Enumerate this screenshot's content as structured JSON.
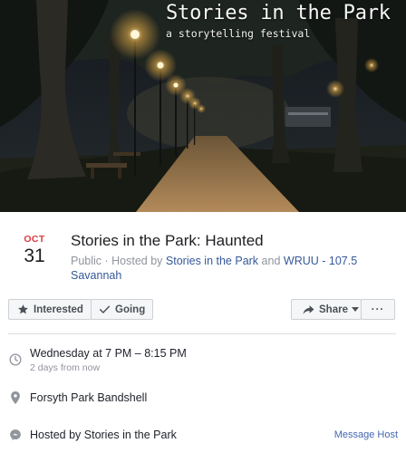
{
  "cover": {
    "title": "Stories in the Park",
    "subtitle": "a storytelling festival"
  },
  "event": {
    "month": "OCT",
    "day": "31",
    "title": "Stories in the Park: Haunted",
    "visibility": "Public",
    "hosted_by_prefix": "Hosted by",
    "host1": "Stories in the Park",
    "and": "and",
    "host2": "WRUU - 107.5 Savannah"
  },
  "actions": {
    "interested": "Interested",
    "going": "Going",
    "share": "Share",
    "more": "···"
  },
  "details": {
    "time": "Wednesday at 7 PM – 8:15 PM",
    "relative": "2 days from now",
    "location": "Forsyth Park Bandshell",
    "hosted": "Hosted by Stories in the Park",
    "message_host": "Message Host"
  },
  "icons": {
    "interested": "star-icon",
    "going": "check-icon",
    "share": "share-arrow-icon",
    "share_caret": "caret-down-icon",
    "time": "clock-icon",
    "location": "location-pin-icon",
    "host": "messenger-icon"
  },
  "colors": {
    "month": "#e0393e",
    "link": "#365899",
    "message_host": "#4267b2",
    "muted": "#90949c"
  }
}
